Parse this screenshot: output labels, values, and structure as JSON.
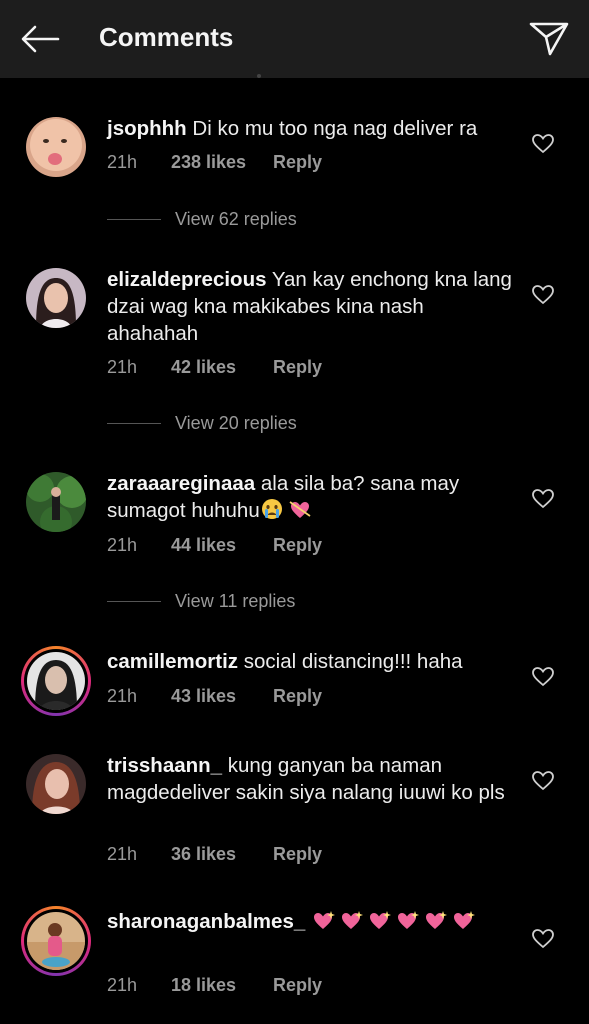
{
  "header": {
    "title": "Comments"
  },
  "comments": [
    {
      "username": "jsophhh",
      "text": "Di ko mu too nga nag deliver ra",
      "time": "21h",
      "likes": "238 likes",
      "reply": "Reply",
      "view_replies": "View 62 replies"
    },
    {
      "username": "elizaldeprecious",
      "text": "Yan kay enchong kna lang dzai wag kna makikabes kina nash ahahahah",
      "time": "21h",
      "likes": "42 likes",
      "reply": "Reply",
      "view_replies": "View 20 replies"
    },
    {
      "username": "zaraaareginaaa",
      "text": "ala sila ba? sana may sumagot huhuhu",
      "time": "21h",
      "likes": "44 likes",
      "reply": "Reply",
      "view_replies": "View 11 replies"
    },
    {
      "username": "camillemortiz",
      "text": "social distancing!!! haha",
      "time": "21h",
      "likes": "43 likes",
      "reply": "Reply"
    },
    {
      "username": "trisshaann_",
      "text": "kung ganyan ba naman magdedeliver sakin siya nalang iuuwi ko pls",
      "time": "21h",
      "likes": "36 likes",
      "reply": "Reply"
    },
    {
      "username": "sharonaganbalmes_",
      "text": "",
      "time": "21h",
      "likes": "18 likes",
      "reply": "Reply"
    }
  ],
  "icons": {
    "back": "arrow-left-icon",
    "send": "paper-plane-icon",
    "like": "heart-outline-icon",
    "crying": "crying-face-emoji",
    "heart_arrow": "heart-with-arrow-emoji",
    "sparkle_heart": "sparkling-heart-emoji"
  },
  "colors": {
    "background": "#000000",
    "header": "#1d1d1d",
    "muted_text": "#9a9a9a",
    "story_ring": "#dd2a7b"
  }
}
